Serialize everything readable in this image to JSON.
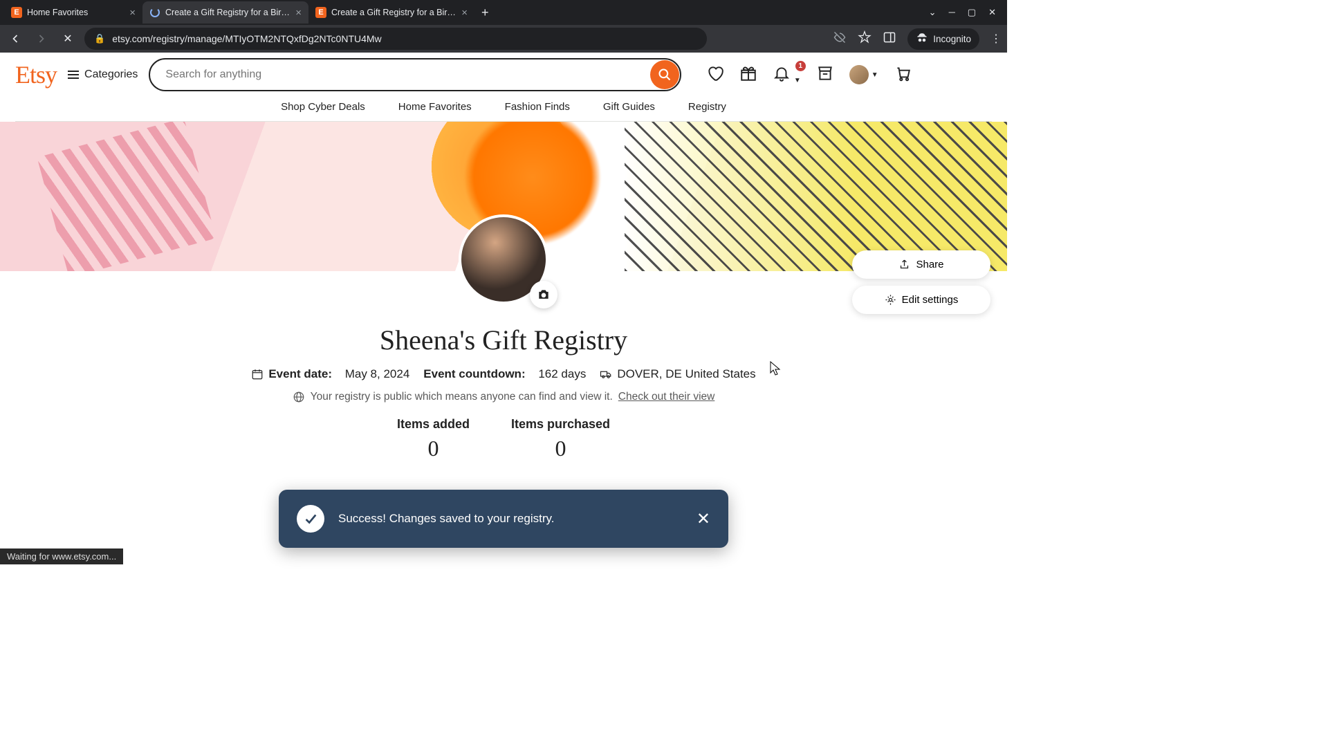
{
  "browser": {
    "tabs": [
      {
        "title": "Home Favorites",
        "favType": "etsy"
      },
      {
        "title": "Create a Gift Registry for a Birth…",
        "favType": "spinner",
        "active": true
      },
      {
        "title": "Create a Gift Registry for a Birth…",
        "favType": "etsy"
      }
    ],
    "url": "etsy.com/registry/manage/MTIyOTM2NTQxfDg2NTc0NTU4Mw",
    "incognito_label": "Incognito",
    "status": "Waiting for www.etsy.com..."
  },
  "header": {
    "logo": "Etsy",
    "categories_label": "Categories",
    "search_placeholder": "Search for anything",
    "notification_badge": "1",
    "nav": [
      "Shop Cyber Deals",
      "Home Favorites",
      "Fashion Finds",
      "Gift Guides",
      "Registry"
    ]
  },
  "actions": {
    "share": "Share",
    "edit": "Edit settings"
  },
  "registry": {
    "title": "Sheena's Gift Registry",
    "event_date_label": "Event date:",
    "event_date": "May 8, 2024",
    "countdown_label": "Event countdown:",
    "countdown": "162 days",
    "location": "DOVER, DE United States",
    "privacy_text": "Your registry is public which means anyone can find and view it.",
    "privacy_link": "Check out their view",
    "stats": {
      "added_label": "Items added",
      "added_value": "0",
      "purchased_label": "Items purchased",
      "purchased_value": "0"
    }
  },
  "toast": {
    "message": "Success! Changes saved to your registry."
  }
}
